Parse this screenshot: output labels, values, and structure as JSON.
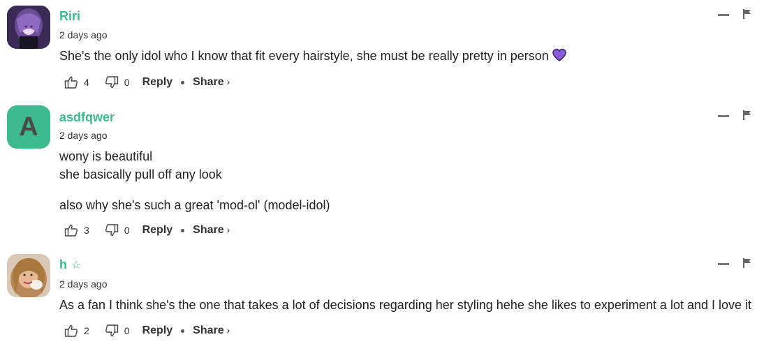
{
  "comments": [
    {
      "author": "Riri",
      "time": "2 days ago",
      "lines": [
        "She's the only idol who I know that fit every hairstyle, she must be really pretty in person"
      ],
      "has_heart_emoji": true,
      "likes": "4",
      "dislikes": "0",
      "reply_label": "Reply",
      "share_label": "Share",
      "avatar_type": "image"
    },
    {
      "author": "asdfqwer",
      "time": "2 days ago",
      "lines": [
        "wony is beautiful",
        "she basically pull off any look",
        "also why she's such a great 'mod-ol' (model-idol)"
      ],
      "avatar_letter": "A",
      "likes": "3",
      "dislikes": "0",
      "reply_label": "Reply",
      "share_label": "Share",
      "avatar_type": "letter"
    },
    {
      "author": "h",
      "time": "2 days ago",
      "lines": [
        "As a fan I think she's the one that takes a lot of decisions regarding her styling hehe she likes to experiment a lot and I love it"
      ],
      "has_star_badge": true,
      "likes": "2",
      "dislikes": "0",
      "reply_label": "Reply",
      "share_label": "Share",
      "avatar_type": "image"
    }
  ],
  "colors": {
    "username": "#3dbb8c",
    "avatar_bg": "#3dbb8c",
    "heart": "#8a5bd8"
  }
}
